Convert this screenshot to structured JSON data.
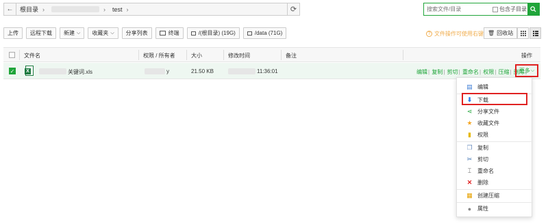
{
  "pathbar": {
    "back_icon": "arrow-left-icon",
    "crumbs": [
      "根目录",
      "",
      "test"
    ],
    "refresh_icon": "refresh-icon"
  },
  "search": {
    "placeholder": "搜索文件/目录",
    "include_sub_label": "包含子目录",
    "search_icon": "search-icon"
  },
  "toolbar": {
    "upload": "上传",
    "remote_download": "远程下载",
    "new": "新建",
    "favorites": "收藏夹",
    "share_list": "分享列表",
    "terminal": "终端",
    "disk_root": "/(根目录) (19G)",
    "disk_data": "/data (71G)"
  },
  "hint": "文件操作可使用右键",
  "recycle_bin": "回收站",
  "table": {
    "headers": {
      "filename": "文件名",
      "permission": "权限 / 所有者",
      "size": "大小",
      "modified": "修改时间",
      "remark": "备注",
      "ops": "操作"
    },
    "rows": [
      {
        "filename": "关键词.xls",
        "size": "21.50 KB",
        "modified": "11:36:01",
        "permission_suffix": "y",
        "actions": [
          "编辑",
          "复制",
          "剪切",
          "重命名",
          "权限",
          "压缩",
          "删除"
        ],
        "more": "更多"
      }
    ]
  },
  "menu": {
    "items": [
      {
        "label": "编辑",
        "icon": "edit-icon"
      },
      {
        "label": "下载",
        "icon": "download-icon"
      },
      {
        "label": "分享文件",
        "icon": "share-icon"
      },
      {
        "label": "收藏文件",
        "icon": "star-icon"
      },
      {
        "label": "权限",
        "icon": "permission-icon"
      },
      {
        "label": "复制",
        "icon": "copy-icon"
      },
      {
        "label": "剪切",
        "icon": "scissors-icon"
      },
      {
        "label": "重命名",
        "icon": "rename-icon"
      },
      {
        "label": "删除",
        "icon": "delete-icon"
      },
      {
        "label": "创建压缩",
        "icon": "archive-icon"
      },
      {
        "label": "属性",
        "icon": "properties-icon"
      }
    ]
  },
  "colors": {
    "accent": "#20a53a",
    "highlight": "#e02020",
    "hint": "#f0ad4e"
  }
}
